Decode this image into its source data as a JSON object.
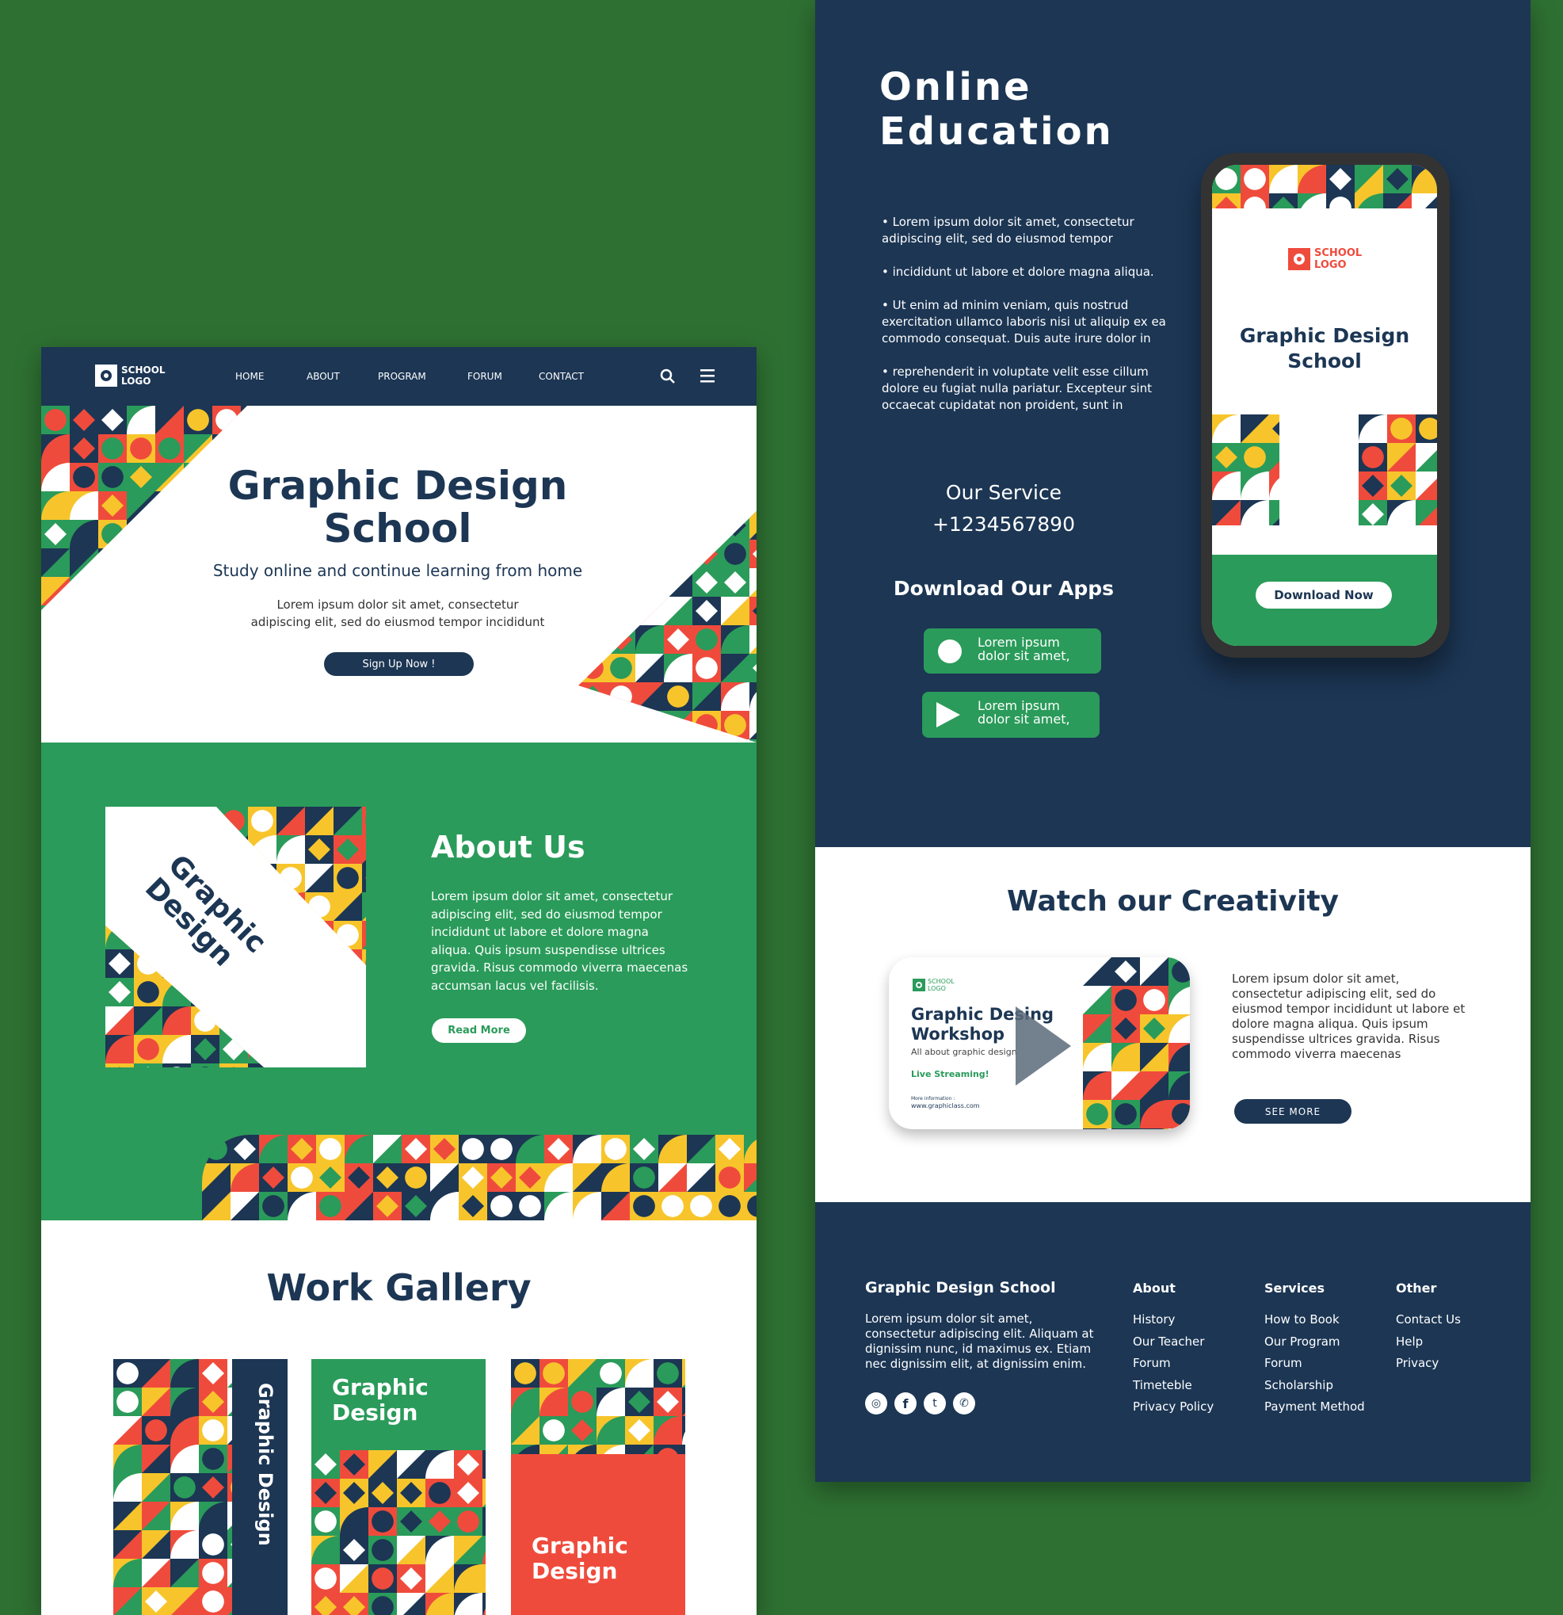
{
  "colors": {
    "background": "#2e7032",
    "navy": "#1c3654",
    "green": "#2a9b5a",
    "red": "#ef4b3c",
    "yellow": "#f7c52b",
    "white": "#ffffff"
  },
  "landing": {
    "logo": {
      "line1": "SCHOOL",
      "line2": "LOGO"
    },
    "nav": [
      {
        "label": "HOME"
      },
      {
        "label": "ABOUT"
      },
      {
        "label": "PROGRAM"
      },
      {
        "label": "FORUM"
      },
      {
        "label": "CONTACT"
      }
    ],
    "icons": {
      "search": "search-icon",
      "menu": "hamburger-menu-icon"
    },
    "hero": {
      "title_line1": "Graphic Design",
      "title_line2": "School",
      "subtitle": "Study online and continue learning from home",
      "body_line1": "Lorem ipsum dolor sit amet, consectetur",
      "body_line2": "adipiscing elit, sed do eiusmod tempor incididunt",
      "cta": "Sign Up Now !"
    },
    "about": {
      "image_text": "Graphic Design",
      "title": "About Us",
      "body": "Lorem ipsum dolor sit amet, consectetur adipiscing elit, sed do eiusmod tempor incididunt ut labore et dolore magna aliqua. Quis ipsum suspendisse ultrices gravida. Risus commodo viverra maecenas accumsan lacus vel facilisis.",
      "button": "Read More"
    },
    "gallery": {
      "title": "Work Gallery",
      "cards": [
        {
          "text": "Graphic Design"
        },
        {
          "text_line1": "Graphic",
          "text_line2": "Design"
        },
        {
          "text_line1": "Graphic",
          "text_line2": "Design"
        }
      ]
    }
  },
  "app": {
    "title_line1": "Online",
    "title_line2": "Education",
    "bullets": [
      "• Lorem ipsum dolor sit amet, consectetur adipiscing elit, sed do eiusmod tempor",
      "• incididunt ut labore et dolore magna aliqua.",
      "• Ut enim ad minim veniam, quis nostrud exercitation ullamco laboris nisi ut aliquip ex ea commodo consequat. Duis aute irure dolor in",
      "• reprehenderit in voluptate velit esse cillum dolore eu fugiat nulla pariatur. Excepteur sint occaecat cupidatat non proident, sunt in"
    ],
    "service_label": "Our Service",
    "phone": "+1234567890",
    "download_title": "Download Our Apps",
    "store_buttons": [
      {
        "icon": "apple-icon",
        "line1": "Lorem ipsum",
        "line2": "dolor sit amet,"
      },
      {
        "icon": "play-store-icon",
        "line1": "Lorem ipsum",
        "line2": "dolor sit amet,"
      }
    ],
    "phone_screen": {
      "logo_line1": "SCHOOL",
      "logo_line2": "LOGO",
      "title_line1": "Graphic Design",
      "title_line2": "School",
      "button": "Download Now"
    },
    "watch": {
      "title": "Watch our Creativity",
      "video": {
        "logo_line1": "SCHOOL",
        "logo_line2": "LOGO",
        "title_line1": "Graphic Desing",
        "title_line2": "Workshop",
        "subtitle": "All about graphic design",
        "live": "Live Streaming!",
        "more_label": "More information :",
        "url": "www.graphiclass.com"
      },
      "body": "Lorem ipsum dolor sit amet, consectetur adipiscing elit, sed do eiusmod tempor incididunt ut labore et dolore magna aliqua. Quis ipsum suspendisse ultrices gravida. Risus commodo viverra maecenas",
      "button": "SEE MORE"
    },
    "footer": {
      "title": "Graphic Design School",
      "body": "Lorem ipsum dolor sit amet, consectetur adipiscing elit. Aliquam at dignissim nunc, id maximus ex. Etiam nec dignissim elit, at dignissim enim.",
      "social": [
        "instagram-icon",
        "facebook-icon",
        "twitter-icon",
        "whatsapp-icon"
      ],
      "columns": [
        {
          "heading": "About",
          "items": [
            "History",
            "Our Teacher",
            "Forum",
            "Timeteble",
            "Privacy Policy"
          ]
        },
        {
          "heading": "Services",
          "items": [
            "How to Book",
            "Our Program",
            "Forum",
            "Scholarship",
            "Payment Method"
          ]
        },
        {
          "heading": "Other",
          "items": [
            "Contact Us",
            "Help",
            "Privacy"
          ]
        }
      ]
    }
  }
}
